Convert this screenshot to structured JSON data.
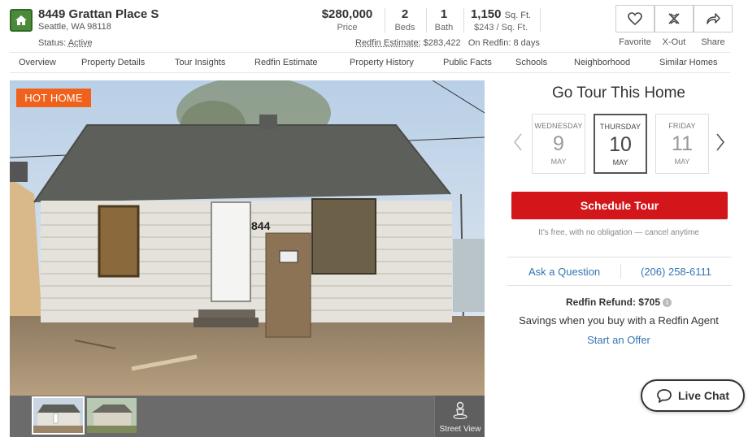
{
  "header": {
    "address": "8449 Grattan Place S",
    "city_state_zip": "Seattle, WA 98118",
    "status_label": "Status:",
    "status_value": "Active",
    "price": "$280,000",
    "price_label": "Price",
    "beds": "2",
    "beds_label": "Beds",
    "baths": "1",
    "baths_label": "Bath",
    "sqft": "1,150",
    "sqft_unit": "Sq. Ft.",
    "price_per_sqft": "$243 / Sq. Ft.",
    "estimate_label": "Redfin Estimate:",
    "estimate_value": "$283,422",
    "on_redfin": "On Redfin: 8 days"
  },
  "actions": {
    "favorite": "Favorite",
    "xout": "X-Out",
    "share": "Share"
  },
  "tabs": [
    "Overview",
    "Property Details",
    "Tour Insights",
    "Redfin Estimate",
    "Property History",
    "Public Facts",
    "Schools",
    "Neighborhood",
    "Similar Homes"
  ],
  "photo": {
    "badge": "HOT HOME",
    "street_view": "Street View"
  },
  "tour": {
    "title": "Go Tour This Home",
    "days": [
      {
        "dow": "WEDNESDAY",
        "num": "9",
        "mon": "MAY"
      },
      {
        "dow": "THURSDAY",
        "num": "10",
        "mon": "MAY"
      },
      {
        "dow": "FRIDAY",
        "num": "11",
        "mon": "MAY"
      }
    ],
    "schedule": "Schedule Tour",
    "free_note": "It’s free, with no obligation — cancel anytime",
    "ask": "Ask a Question",
    "phone": "(206) 258-6111",
    "refund": "Redfin Refund: $705",
    "savings": "Savings when you buy with a Redfin Agent",
    "offer": "Start an Offer"
  },
  "chat": {
    "label": "Live Chat"
  },
  "colors": {
    "brand_red": "#d3161a",
    "hot_orange": "#f0621b",
    "link_blue": "#3575b5",
    "logo_green": "#4a8a3a"
  }
}
